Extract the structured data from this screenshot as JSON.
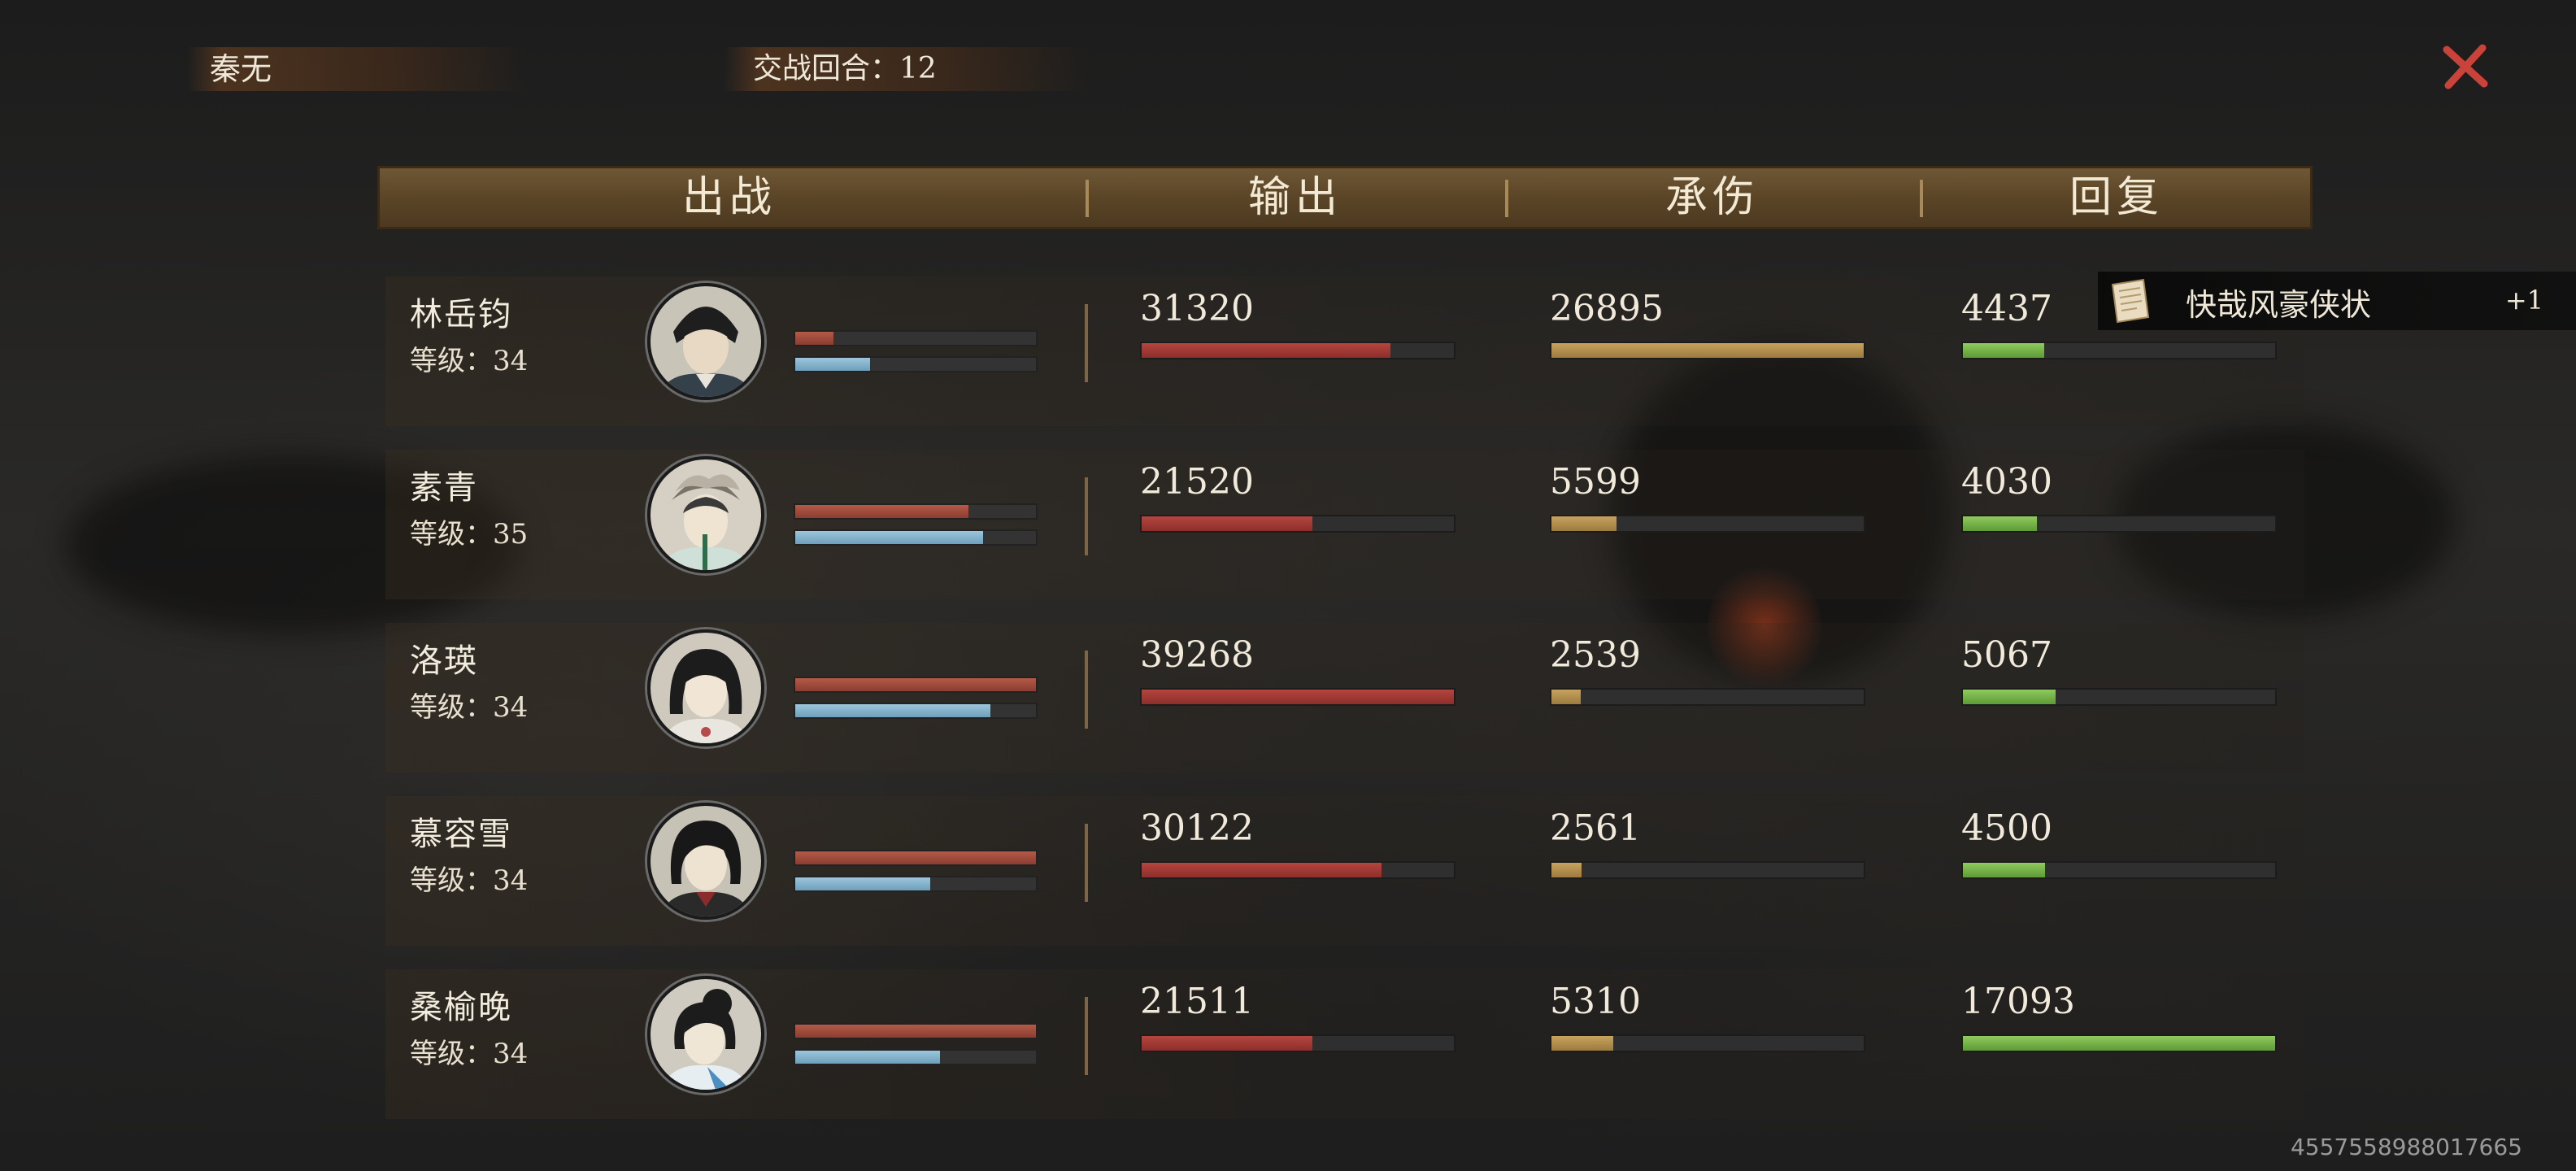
{
  "player_name": "秦无",
  "round_label": "交战回合：12",
  "header": {
    "col_fighters": "出战",
    "col_output": "输出",
    "col_damage_taken": "承伤",
    "col_healing": "回复"
  },
  "characters": [
    {
      "name": "林岳钧",
      "level": "等级：34",
      "hp_fraction": 0.16,
      "mp_fraction": 0.31,
      "output": "31320",
      "taken": "26895",
      "healing": "4437"
    },
    {
      "name": "素青",
      "level": "等级：35",
      "hp_fraction": 0.72,
      "mp_fraction": 0.78,
      "output": "21520",
      "taken": "5599",
      "healing": "4030"
    },
    {
      "name": "洛瑛",
      "level": "等级：34",
      "hp_fraction": 1.0,
      "mp_fraction": 0.81,
      "output": "39268",
      "taken": "2539",
      "healing": "5067"
    },
    {
      "name": "慕容雪",
      "level": "等级：34",
      "hp_fraction": 1.0,
      "mp_fraction": 0.56,
      "output": "30122",
      "taken": "2561",
      "healing": "4500"
    },
    {
      "name": "桑榆晚",
      "level": "等级：34",
      "hp_fraction": 1.0,
      "mp_fraction": 0.6,
      "output": "21511",
      "taken": "5310",
      "healing": "17093"
    }
  ],
  "award": {
    "label": "快哉风豪侠状",
    "count": "+1"
  },
  "footer_id": "4557558988017665",
  "colors": {
    "output": "#b5453f",
    "taken": "#c8a25e",
    "healing": "#8fcb5e",
    "hp": "#b45a48",
    "mp": "#9cc6dc",
    "header_bg": "#5b4527"
  }
}
